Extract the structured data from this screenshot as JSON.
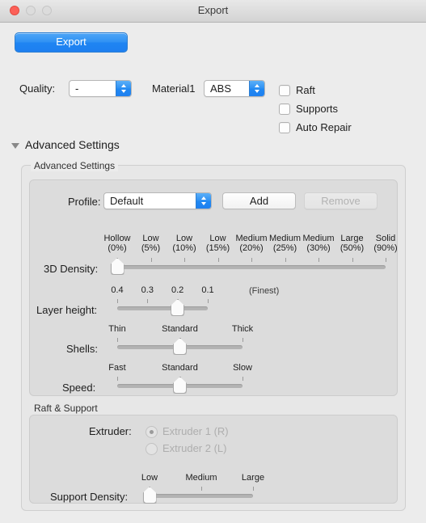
{
  "window": {
    "title": "Export",
    "traffic_lights": [
      "close",
      "minimize",
      "zoom"
    ]
  },
  "toolbar": {
    "export_label": "Export"
  },
  "quality": {
    "label": "Quality:",
    "value": "-"
  },
  "material": {
    "label": "Material1",
    "value": "ABS"
  },
  "checkboxes": [
    {
      "label": "Raft",
      "checked": false
    },
    {
      "label": "Supports",
      "checked": false
    },
    {
      "label": "Auto Repair",
      "checked": false
    }
  ],
  "disclosure": {
    "label": "Advanced Settings",
    "expanded": true
  },
  "advanced": {
    "group_title": "Advanced Settings",
    "profile": {
      "label": "Profile:",
      "value": "Default",
      "add_label": "Add",
      "remove_label": "Remove",
      "remove_disabled": true
    },
    "sliders": [
      {
        "name": "3d-density",
        "label": "3D Density:",
        "value_index": 0,
        "ticks": [
          {
            "top": "Hollow",
            "bottom": "(0%)"
          },
          {
            "top": "Low",
            "bottom": "(5%)"
          },
          {
            "top": "Low",
            "bottom": "(10%)"
          },
          {
            "top": "Low",
            "bottom": "(15%)"
          },
          {
            "top": "Medium",
            "bottom": "(20%)"
          },
          {
            "top": "Medium",
            "bottom": "(25%)"
          },
          {
            "top": "Medium",
            "bottom": "(30%)"
          },
          {
            "top": "Large",
            "bottom": "(50%)"
          },
          {
            "top": "Solid",
            "bottom": "(90%)"
          }
        ]
      },
      {
        "name": "layer-height",
        "label": "Layer height:",
        "value_index": 2,
        "note": "(Finest)",
        "ticks": [
          {
            "top": "0.4"
          },
          {
            "top": "0.3"
          },
          {
            "top": "0.2"
          },
          {
            "top": "0.1"
          }
        ]
      },
      {
        "name": "shells",
        "label": "Shells:",
        "value_index": 1,
        "ticks": [
          {
            "top": "Thin"
          },
          {
            "top": "Standard"
          },
          {
            "top": "Thick"
          }
        ]
      },
      {
        "name": "speed",
        "label": "Speed:",
        "value_index": 1,
        "ticks": [
          {
            "top": "Fast"
          },
          {
            "top": "Standard"
          },
          {
            "top": "Slow"
          }
        ]
      }
    ]
  },
  "raft_support": {
    "group_title": "Raft & Support",
    "extruder": {
      "label": "Extruder:",
      "disabled": true,
      "options": [
        {
          "label": "Extruder 1 (R)",
          "selected": true
        },
        {
          "label": "Extruder 2 (L)",
          "selected": false
        }
      ]
    },
    "support_density": {
      "name": "support-density",
      "label": "Support Density:",
      "value_index": 0,
      "ticks": [
        {
          "top": "Low"
        },
        {
          "top": "Medium"
        },
        {
          "top": "Large"
        }
      ]
    }
  },
  "colors": {
    "accent": "#2e90f3",
    "window_bg": "#ececec",
    "group_bg": "#dcdcdc",
    "close_button": "#fc6058"
  }
}
